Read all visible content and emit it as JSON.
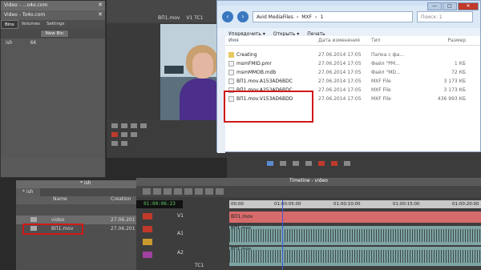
{
  "bin": {
    "title": "Video - ...o4o.com",
    "title2": "Video - To4o.com",
    "tabs": [
      "Bins",
      "Volumes",
      "Settings"
    ],
    "new_bin_label": "New Bin",
    "items": [
      {
        "name": "ish",
        "size": "6K"
      }
    ]
  },
  "monitor": {
    "clip_name": "ВП1.mov",
    "timecode_label": "V1  TC1"
  },
  "explorer": {
    "path": [
      "Avid MediaFiles",
      "MXF",
      "1"
    ],
    "search_placeholder": "Поиск: 1",
    "toolbar": [
      "Упорядочить ▾",
      "Открыть ▾",
      "Печать"
    ],
    "columns": [
      "Имя",
      "Дата изменения",
      "Тип",
      "Размер"
    ],
    "rows": [
      {
        "name": "Creating",
        "date": "27.06.2014 17:05",
        "type": "Папка с фа...",
        "size": "",
        "icon": "folder"
      },
      {
        "name": "msmFMID.pmr",
        "date": "27.06.2014 17:05",
        "type": "Файл \"PM...",
        "size": "1 КБ",
        "icon": "file"
      },
      {
        "name": "msmMMOB.mdb",
        "date": "27.06.2014 17:05",
        "type": "Файл \"MD...",
        "size": "72 КБ",
        "icon": "file"
      },
      {
        "name": "ВП1.mov.A153AD6BDC",
        "date": "27.06.2014 17:05",
        "type": "MXF File",
        "size": "3 173 КБ",
        "icon": "file"
      },
      {
        "name": "ВП1.mov.A253AD6BDC",
        "date": "27.06.2014 17:05",
        "type": "MXF File",
        "size": "3 173 КБ",
        "icon": "file"
      },
      {
        "name": "ВП1.mov.V153AD6BDD",
        "date": "27.06.2014 17:05",
        "type": "MXF File",
        "size": "436 993 КБ",
        "icon": "file"
      }
    ],
    "window_buttons": [
      "—",
      "□",
      "✕"
    ]
  },
  "bin2": {
    "title": "* ish",
    "tab": "* ish",
    "columns": [
      "Name",
      "Creation"
    ],
    "rows": [
      {
        "name": "video",
        "date": "27.06.201"
      },
      {
        "name": "ВП1.mov",
        "date": "27.06.201"
      }
    ]
  },
  "timeline": {
    "title": "Timeline - video",
    "timecode": "01:00:06:23",
    "ruler": [
      "00:00",
      "01:00:05:00",
      "01:00:10:00",
      "01:00:15:00",
      "01:00:20:00"
    ],
    "tracks": [
      "V1",
      "A1",
      "A2",
      "TC1"
    ],
    "clip_label": "ВП1.mov"
  }
}
